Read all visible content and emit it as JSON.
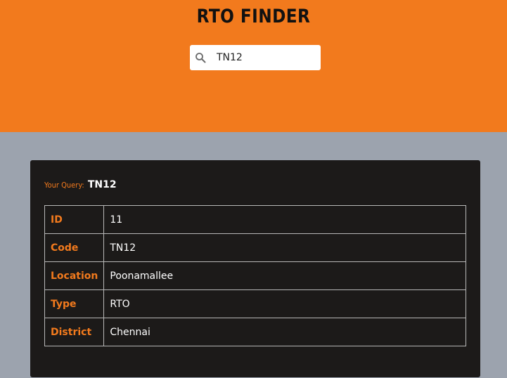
{
  "header": {
    "title": "RTO FINDER",
    "search": {
      "value": "TN12",
      "icon": "search-icon"
    }
  },
  "result": {
    "query_label": "Your Query:",
    "query_value": "TN12",
    "rows": [
      {
        "key": "ID",
        "value": "11"
      },
      {
        "key": "Code",
        "value": "TN12"
      },
      {
        "key": "Location",
        "value": "Poonamallee"
      },
      {
        "key": "Type",
        "value": "RTO"
      },
      {
        "key": "District",
        "value": "Chennai"
      }
    ]
  },
  "colors": {
    "accent": "#f27a1d",
    "page_background": "#9ca3ae",
    "card_background": "#1c1a19"
  }
}
